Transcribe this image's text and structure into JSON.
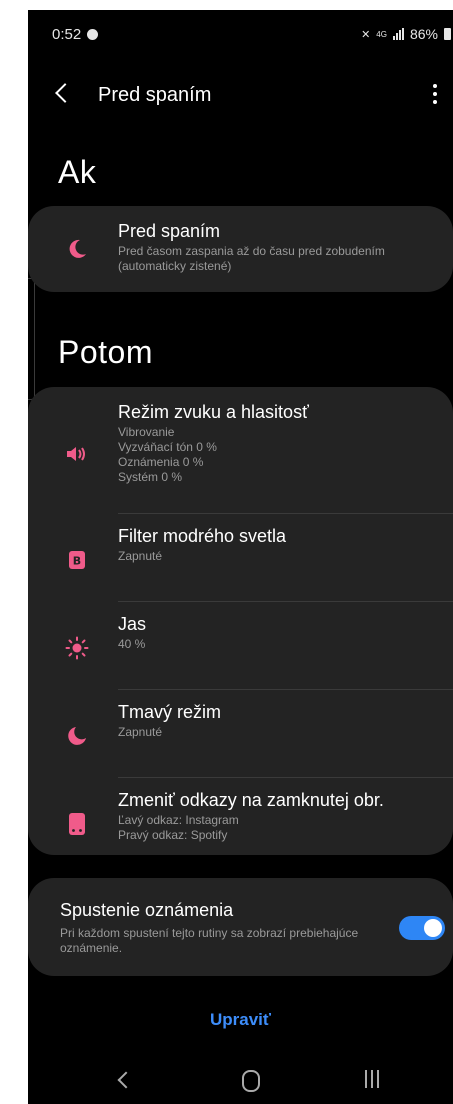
{
  "status_bar": {
    "time": "0:52",
    "battery": "86%",
    "network_small": "4G"
  },
  "app_bar": {
    "title": "Pred spaním"
  },
  "if_section": {
    "heading": "Ak",
    "item": {
      "title": "Pred spaním",
      "subtitle": "Pred časom zaspania až do času pred zobudením (automaticky zistené)",
      "icon": "moon-icon"
    }
  },
  "then_section": {
    "heading": "Potom",
    "items": [
      {
        "title": "Režim zvuku a hlasitosť",
        "lines": [
          "Vibrovanie",
          "Vyzváňací tón 0 %",
          "Oznámenia 0 %",
          "Systém 0 %"
        ],
        "icon": "speaker-icon"
      },
      {
        "title": "Filter modrého svetla",
        "lines": [
          "Zapnuté"
        ],
        "icon": "blue-light-filter-icon"
      },
      {
        "title": "Jas",
        "lines": [
          "40 %"
        ],
        "icon": "brightness-icon"
      },
      {
        "title": "Tmavý režim",
        "lines": [
          "Zapnuté"
        ],
        "icon": "dark-mode-icon"
      },
      {
        "title": "Zmeniť odkazy na zamknutej obr.",
        "lines": [
          "Ľavý odkaz: Instagram",
          "Pravý odkaz: Spotify"
        ],
        "icon": "lockscreen-shortcut-icon"
      }
    ]
  },
  "notification_toggle": {
    "label": "Spustenie oznámenia",
    "description": "Pri každom spustení tejto rutiny sa zobrazí prebiehajúce oznámenie.",
    "enabled": true
  },
  "edit_label": "Upraviť",
  "colors": {
    "accent_pink": "#f05b8a",
    "accent_blue": "#3d8dfa",
    "card_bg": "#232323"
  }
}
